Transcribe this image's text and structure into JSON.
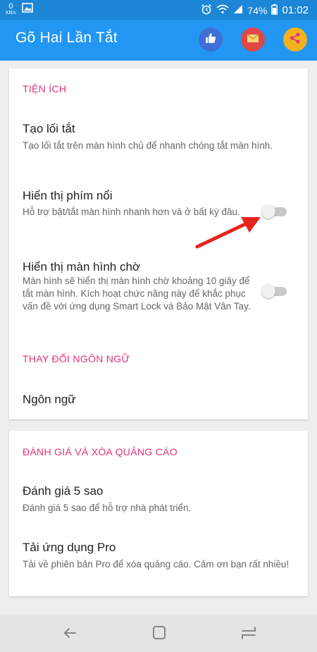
{
  "status_bar": {
    "speed_value": "0",
    "speed_unit": "KB/s",
    "battery": "74%",
    "time": "01:02",
    "icons": [
      "image-icon",
      "alarm-icon",
      "wifi-icon",
      "signal-icon",
      "battery-icon"
    ]
  },
  "app_bar": {
    "title": "Gõ Hai Lần Tắt",
    "actions": [
      {
        "name": "like-icon",
        "color": "#3f6fd6"
      },
      {
        "name": "mail-icon",
        "color": "#e04848"
      },
      {
        "name": "share-icon",
        "color": "#f2b21f"
      }
    ]
  },
  "card1": {
    "section_utilities": "TIỆN ÍCH",
    "shortcut": {
      "title": "Tạo lối tắt",
      "subtitle": "Tạo lối tắt trên màn hình chủ để nhanh chóng tắt màn hình."
    },
    "floating_button": {
      "title": "Hiển thị phím nổi",
      "subtitle": "Hỗ trợ bật/tắt màn hình nhanh hơn và ở bất kỳ đâu.",
      "enabled": false
    },
    "standby_screen": {
      "title": "Hiển thị màn hình chờ",
      "subtitle": "Màn hình sẽ hiển thị màn hình chờ khoảng 10 giây để tắt màn hình. Kích hoạt chức năng này để khắc phục vấn đề với ứng dụng Smart Lock và Bảo Mật Vân Tay.",
      "enabled": false
    },
    "section_language": "THAY ĐỔI NGÔN NGỮ",
    "language": {
      "title": "Ngôn ngữ"
    }
  },
  "card2": {
    "section_rate": "ĐÁNH GIÁ VÀ XÓA QUẢNG CÁO",
    "rate": {
      "title": "Đánh giá 5 sao",
      "subtitle": "Đánh giá 5 sao để hỗ trợ nhà phát triển."
    },
    "pro": {
      "title": "Tải ứng dụng Pro",
      "subtitle": "Tải về phiên bản Pro để xóa quảng cáo. Cảm ơn bạn rất nhiều!"
    }
  },
  "colors": {
    "app_bar": "#2196f3",
    "status_bar": "#1d86d6",
    "section_header": "#e0327b",
    "annotation_arrow": "#e8231e"
  },
  "nav_bar": {
    "buttons": [
      "back-icon",
      "home-icon",
      "recents-icon"
    ]
  }
}
